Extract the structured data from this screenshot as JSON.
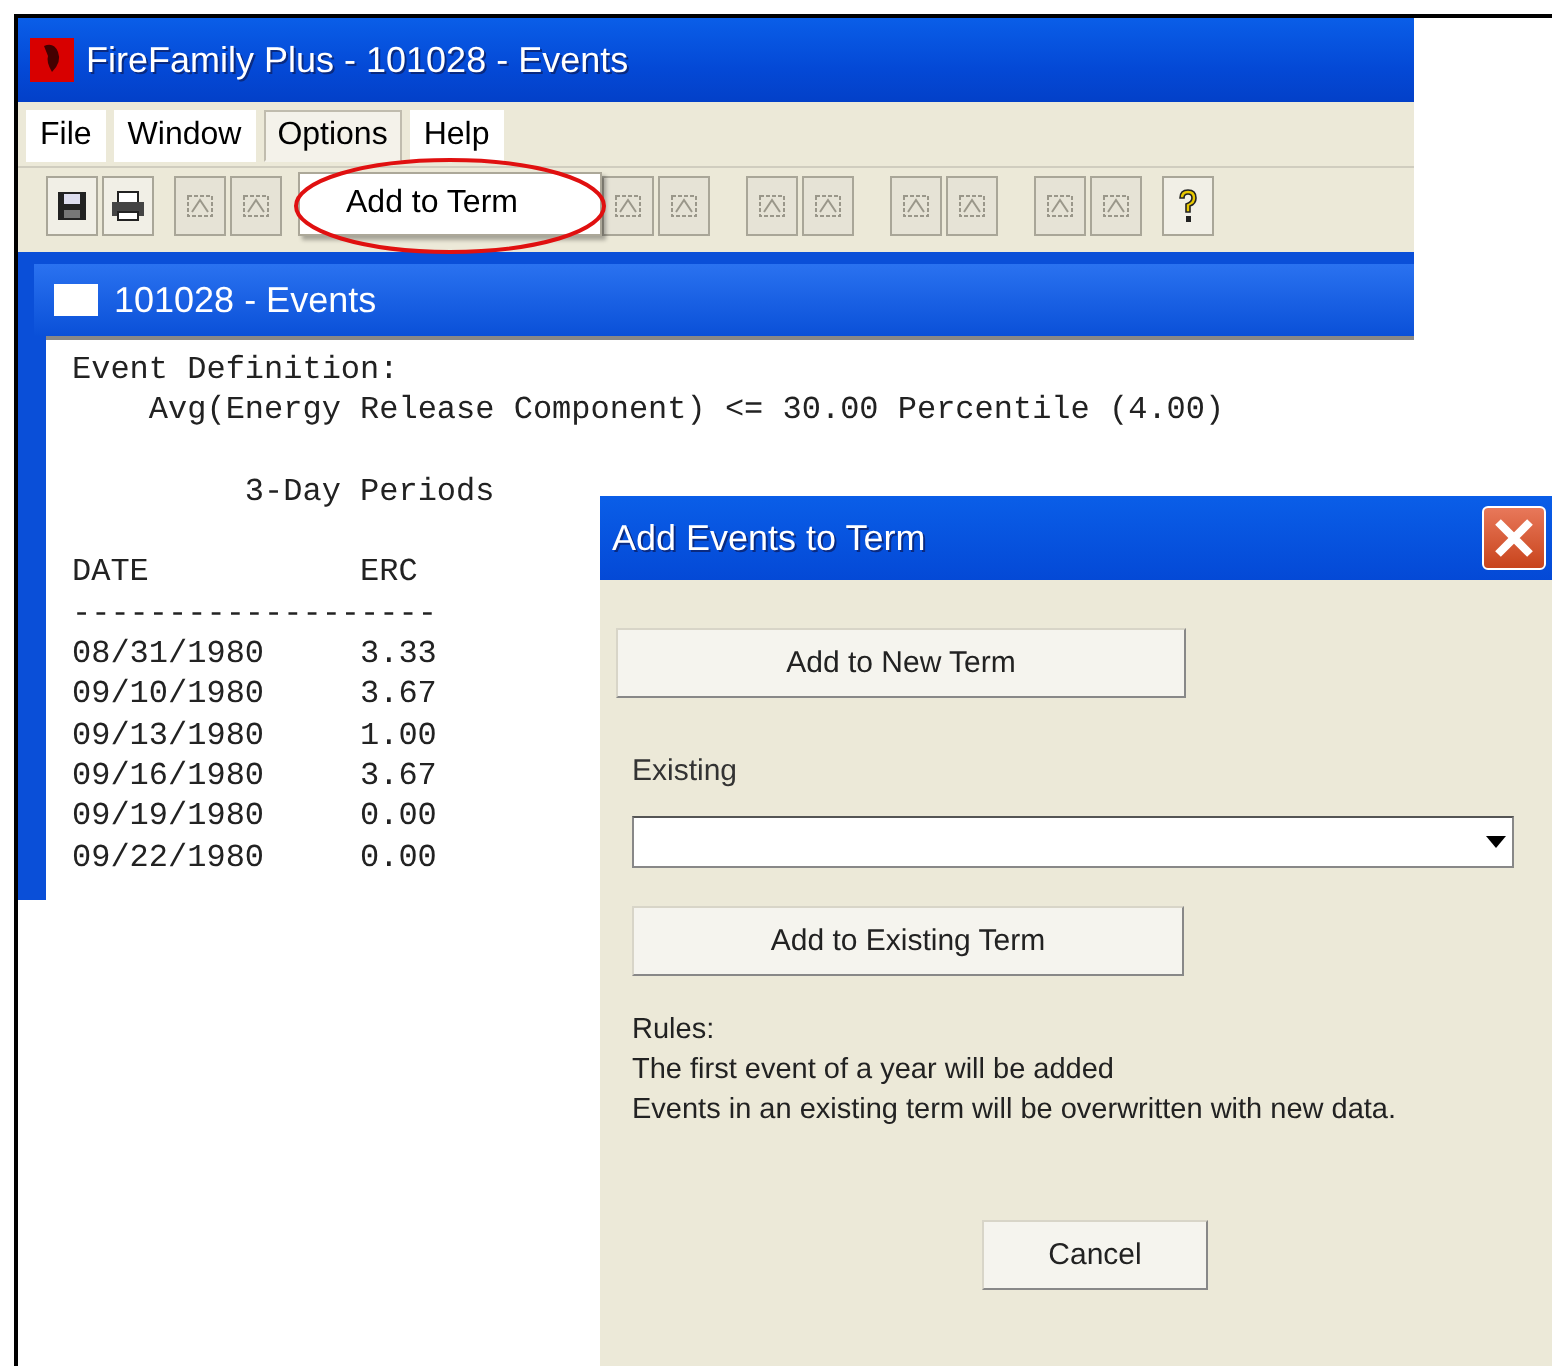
{
  "main_window": {
    "title": "FireFamily Plus - 101028 - Events",
    "menu": [
      {
        "label": "File",
        "selected": false
      },
      {
        "label": "Window",
        "selected": false
      },
      {
        "label": "Options",
        "selected": true
      },
      {
        "label": "Help",
        "selected": false
      }
    ],
    "open_menu": {
      "items": [
        "Add to Term"
      ]
    },
    "toolbar": [
      [
        {
          "kind": "save",
          "disabled": false
        },
        {
          "kind": "print",
          "disabled": false
        }
      ],
      [
        {
          "kind": "tool",
          "disabled": true
        },
        {
          "kind": "tool",
          "disabled": true
        }
      ],
      [
        {
          "kind": "tool",
          "disabled": true
        },
        {
          "kind": "tool",
          "disabled": true
        }
      ],
      [
        {
          "kind": "tool",
          "disabled": true
        },
        {
          "kind": "tool",
          "disabled": true
        }
      ],
      [
        {
          "kind": "tool",
          "disabled": true
        },
        {
          "kind": "tool",
          "disabled": true
        }
      ],
      [
        {
          "kind": "tool",
          "disabled": true
        },
        {
          "kind": "tool",
          "disabled": true
        }
      ],
      [
        {
          "kind": "help",
          "disabled": false
        }
      ]
    ],
    "child_window": {
      "title": "101028 - Events",
      "definition": [
        "Event Definition:",
        "    Avg(Energy Release Component) <= 30.00 Percentile (4.00)"
      ],
      "period_heading": "         3-Day Periods",
      "columns": [
        "DATE",
        "ERC"
      ],
      "separator": "-------------------",
      "rows": [
        {
          "date": "08/31/1980",
          "erc": "3.33"
        },
        {
          "date": "09/10/1980",
          "erc": "3.67"
        },
        {
          "date": "09/13/1980",
          "erc": "1.00"
        },
        {
          "date": "09/16/1980",
          "erc": "3.67"
        },
        {
          "date": "09/19/1980",
          "erc": "0.00"
        },
        {
          "date": "09/22/1980",
          "erc": "0.00"
        }
      ]
    }
  },
  "dialog": {
    "title": "Add Events to Term",
    "new_term_button": "Add to New Term",
    "existing_label": "Existing",
    "existing_button": "Add to Existing Term",
    "rules": [
      "Rules:",
      "The first event of a year will be added",
      "Events in an existing term will be overwritten with new data."
    ],
    "cancel_button": "Cancel"
  }
}
